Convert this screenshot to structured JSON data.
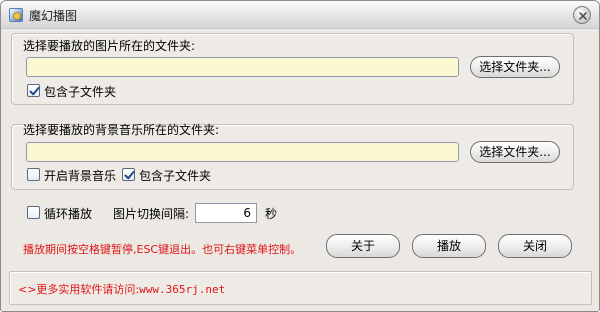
{
  "window": {
    "title": "魔幻播图",
    "icon": "app-picture-icon",
    "close_icon": "close-icon"
  },
  "images_group": {
    "label": "选择要播放的图片所在的文件夹:",
    "path_value": "",
    "browse_label": "选择文件夹...",
    "include_subfolders": {
      "label": "包含子文件夹",
      "checked": true
    }
  },
  "music_group": {
    "label": "选择要播放的背景音乐所在的文件夹:",
    "path_value": "",
    "browse_label": "选择文件夹...",
    "enable_music": {
      "label": "开启背景音乐",
      "checked": false
    },
    "include_subfolders": {
      "label": "包含子文件夹",
      "checked": true
    }
  },
  "options": {
    "loop": {
      "label": "循环播放",
      "checked": false
    },
    "interval_label": "图片切换间隔:",
    "interval_value": "6",
    "interval_unit": "秒"
  },
  "hint": "播放期间按空格键暂停,ESC键退出。也可右键菜单控制。",
  "buttons": {
    "about": "关于",
    "play": "播放",
    "close": "关闭"
  },
  "footer": {
    "prefix": "<>更多实用软件请访问:",
    "url": "www.365rj.net"
  },
  "colors": {
    "accent_red": "#e01515",
    "input_yellow": "#fbf8d2",
    "window_bg": "#ece9e4"
  }
}
